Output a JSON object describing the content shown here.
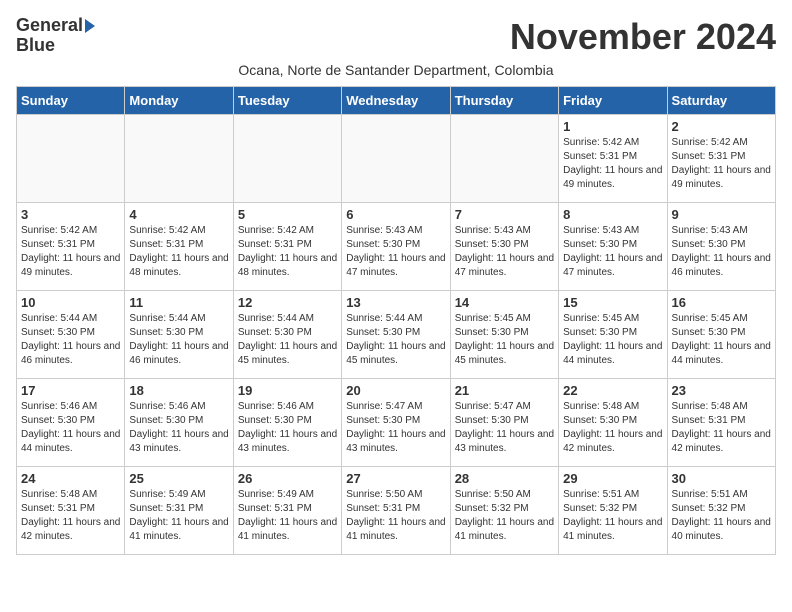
{
  "header": {
    "logo_line1": "General",
    "logo_line2": "Blue",
    "month": "November 2024",
    "subtitle": "Ocana, Norte de Santander Department, Colombia"
  },
  "days_of_week": [
    "Sunday",
    "Monday",
    "Tuesday",
    "Wednesday",
    "Thursday",
    "Friday",
    "Saturday"
  ],
  "weeks": [
    [
      {
        "day": "",
        "info": ""
      },
      {
        "day": "",
        "info": ""
      },
      {
        "day": "",
        "info": ""
      },
      {
        "day": "",
        "info": ""
      },
      {
        "day": "",
        "info": ""
      },
      {
        "day": "1",
        "info": "Sunrise: 5:42 AM\nSunset: 5:31 PM\nDaylight: 11 hours and 49 minutes."
      },
      {
        "day": "2",
        "info": "Sunrise: 5:42 AM\nSunset: 5:31 PM\nDaylight: 11 hours and 49 minutes."
      }
    ],
    [
      {
        "day": "3",
        "info": "Sunrise: 5:42 AM\nSunset: 5:31 PM\nDaylight: 11 hours and 49 minutes."
      },
      {
        "day": "4",
        "info": "Sunrise: 5:42 AM\nSunset: 5:31 PM\nDaylight: 11 hours and 48 minutes."
      },
      {
        "day": "5",
        "info": "Sunrise: 5:42 AM\nSunset: 5:31 PM\nDaylight: 11 hours and 48 minutes."
      },
      {
        "day": "6",
        "info": "Sunrise: 5:43 AM\nSunset: 5:30 PM\nDaylight: 11 hours and 47 minutes."
      },
      {
        "day": "7",
        "info": "Sunrise: 5:43 AM\nSunset: 5:30 PM\nDaylight: 11 hours and 47 minutes."
      },
      {
        "day": "8",
        "info": "Sunrise: 5:43 AM\nSunset: 5:30 PM\nDaylight: 11 hours and 47 minutes."
      },
      {
        "day": "9",
        "info": "Sunrise: 5:43 AM\nSunset: 5:30 PM\nDaylight: 11 hours and 46 minutes."
      }
    ],
    [
      {
        "day": "10",
        "info": "Sunrise: 5:44 AM\nSunset: 5:30 PM\nDaylight: 11 hours and 46 minutes."
      },
      {
        "day": "11",
        "info": "Sunrise: 5:44 AM\nSunset: 5:30 PM\nDaylight: 11 hours and 46 minutes."
      },
      {
        "day": "12",
        "info": "Sunrise: 5:44 AM\nSunset: 5:30 PM\nDaylight: 11 hours and 45 minutes."
      },
      {
        "day": "13",
        "info": "Sunrise: 5:44 AM\nSunset: 5:30 PM\nDaylight: 11 hours and 45 minutes."
      },
      {
        "day": "14",
        "info": "Sunrise: 5:45 AM\nSunset: 5:30 PM\nDaylight: 11 hours and 45 minutes."
      },
      {
        "day": "15",
        "info": "Sunrise: 5:45 AM\nSunset: 5:30 PM\nDaylight: 11 hours and 44 minutes."
      },
      {
        "day": "16",
        "info": "Sunrise: 5:45 AM\nSunset: 5:30 PM\nDaylight: 11 hours and 44 minutes."
      }
    ],
    [
      {
        "day": "17",
        "info": "Sunrise: 5:46 AM\nSunset: 5:30 PM\nDaylight: 11 hours and 44 minutes."
      },
      {
        "day": "18",
        "info": "Sunrise: 5:46 AM\nSunset: 5:30 PM\nDaylight: 11 hours and 43 minutes."
      },
      {
        "day": "19",
        "info": "Sunrise: 5:46 AM\nSunset: 5:30 PM\nDaylight: 11 hours and 43 minutes."
      },
      {
        "day": "20",
        "info": "Sunrise: 5:47 AM\nSunset: 5:30 PM\nDaylight: 11 hours and 43 minutes."
      },
      {
        "day": "21",
        "info": "Sunrise: 5:47 AM\nSunset: 5:30 PM\nDaylight: 11 hours and 43 minutes."
      },
      {
        "day": "22",
        "info": "Sunrise: 5:48 AM\nSunset: 5:30 PM\nDaylight: 11 hours and 42 minutes."
      },
      {
        "day": "23",
        "info": "Sunrise: 5:48 AM\nSunset: 5:31 PM\nDaylight: 11 hours and 42 minutes."
      }
    ],
    [
      {
        "day": "24",
        "info": "Sunrise: 5:48 AM\nSunset: 5:31 PM\nDaylight: 11 hours and 42 minutes."
      },
      {
        "day": "25",
        "info": "Sunrise: 5:49 AM\nSunset: 5:31 PM\nDaylight: 11 hours and 41 minutes."
      },
      {
        "day": "26",
        "info": "Sunrise: 5:49 AM\nSunset: 5:31 PM\nDaylight: 11 hours and 41 minutes."
      },
      {
        "day": "27",
        "info": "Sunrise: 5:50 AM\nSunset: 5:31 PM\nDaylight: 11 hours and 41 minutes."
      },
      {
        "day": "28",
        "info": "Sunrise: 5:50 AM\nSunset: 5:32 PM\nDaylight: 11 hours and 41 minutes."
      },
      {
        "day": "29",
        "info": "Sunrise: 5:51 AM\nSunset: 5:32 PM\nDaylight: 11 hours and 41 minutes."
      },
      {
        "day": "30",
        "info": "Sunrise: 5:51 AM\nSunset: 5:32 PM\nDaylight: 11 hours and 40 minutes."
      }
    ]
  ]
}
